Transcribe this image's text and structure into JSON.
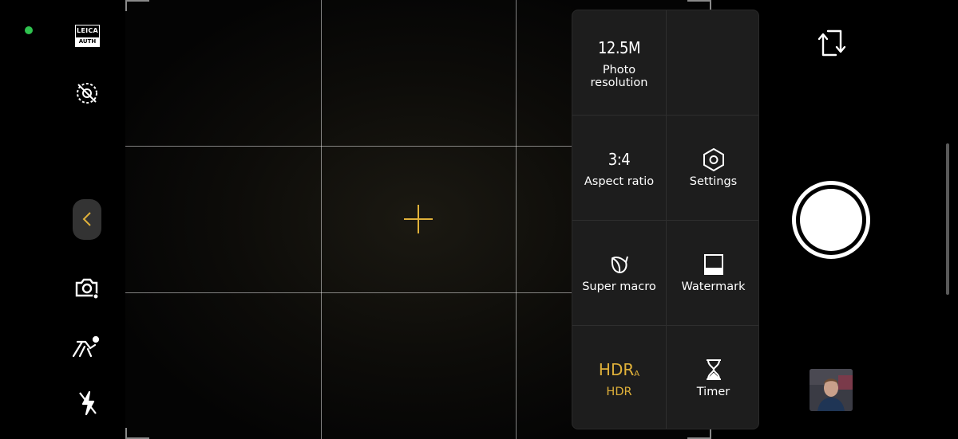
{
  "status": {
    "camera_active_indicator": "green-dot"
  },
  "left_rail": {
    "leica_badge": {
      "top": "LEICA",
      "bottom": "AUTH"
    },
    "icons": [
      "leica-auth-icon",
      "ai-scene-off-icon",
      "back-chevron-icon",
      "lens-mode-icon",
      "motion-capture-icon",
      "flash-off-icon"
    ]
  },
  "viewfinder": {
    "grid": "3x3",
    "focus_indicator": "crosshair"
  },
  "quick_settings": {
    "tiles": [
      {
        "value": "12.5M",
        "label": "Photo resolution",
        "active": false
      },
      {
        "value": "",
        "label": "",
        "active": false
      },
      {
        "value": "3:4",
        "label": "Aspect ratio",
        "active": false
      },
      {
        "icon": "hexagon-settings-icon",
        "label": "Settings",
        "active": false
      },
      {
        "icon": "super-macro-icon",
        "label": "Super macro",
        "active": false
      },
      {
        "icon": "watermark-icon",
        "label": "Watermark",
        "active": false
      },
      {
        "value": "HDR",
        "value_sub": "A",
        "label": "HDR",
        "active": true
      },
      {
        "icon": "hourglass-icon",
        "label": "Timer",
        "active": false
      }
    ]
  },
  "right_rail": {
    "switch_camera_icon": "switch-camera-icon",
    "shutter": "shutter-button",
    "gallery_thumbnail": "last-photo-thumbnail"
  },
  "colors": {
    "accent": "#e0b13a",
    "panel": "#1d1d1d",
    "status_green": "#2fc24f"
  }
}
